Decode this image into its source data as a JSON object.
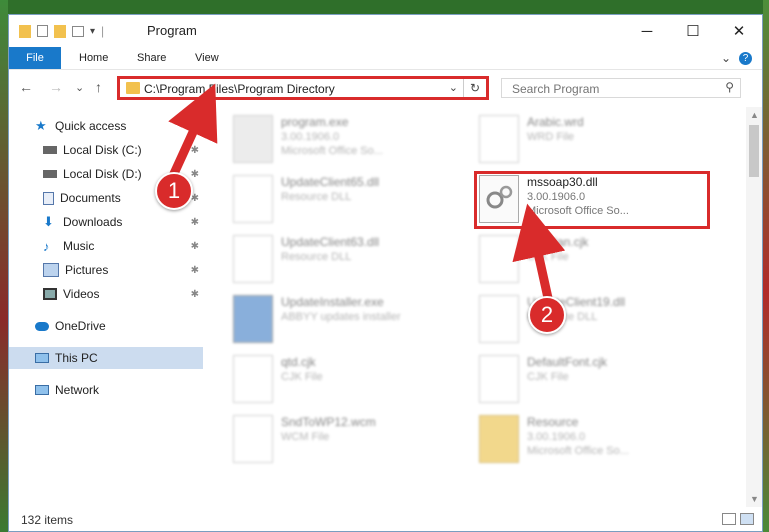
{
  "window": {
    "title": "Program",
    "controls": {
      "minimize": "─",
      "maximize": "☐",
      "close": "✕"
    }
  },
  "ribbon": {
    "file": "File",
    "tabs": [
      "Home",
      "Share",
      "View"
    ],
    "expand": "⌄",
    "help": "?"
  },
  "nav": {
    "back": "←",
    "forward": "→",
    "recent": "⌄",
    "up": "↑",
    "address": "C:\\Program Files\\Program Directory",
    "dropdown": "⌄",
    "refresh": "↻",
    "search_placeholder": "Search Program",
    "search_icon": "⚲"
  },
  "sidebar": {
    "items": [
      {
        "label": "Quick access",
        "icon": "star-icon"
      },
      {
        "label": "Local Disk (C:)",
        "icon": "drive-icon",
        "pin": "✱"
      },
      {
        "label": "Local Disk (D:)",
        "icon": "drive-icon",
        "pin": "✱"
      },
      {
        "label": "Documents",
        "icon": "documents-icon",
        "pin": "✱"
      },
      {
        "label": "Downloads",
        "icon": "download-icon",
        "pin": "✱"
      },
      {
        "label": "Music",
        "icon": "music-icon",
        "pin": "✱"
      },
      {
        "label": "Pictures",
        "icon": "pictures-icon",
        "pin": "✱"
      },
      {
        "label": "Videos",
        "icon": "videos-icon",
        "pin": "✱"
      },
      {
        "label": "OneDrive",
        "icon": "cloud-icon"
      },
      {
        "label": "This PC",
        "icon": "pc-icon"
      },
      {
        "label": "Network",
        "icon": "network-icon"
      }
    ]
  },
  "files": [
    {
      "name": "program.exe",
      "line2": "3.00.1906.0",
      "line3": "Microsoft Office So..."
    },
    {
      "name": "Arabic.wrd",
      "line2": "WRD File",
      "line3": ""
    },
    {
      "name": "UpdateClient65.dll",
      "line2": "Resource DLL",
      "line3": ""
    },
    {
      "name": "mssoap30.dll",
      "line2": "3.00.1906.0",
      "line3": "Microsoft Office So..."
    },
    {
      "name": "UpdateClient63.dll",
      "line2": "Resource DLL",
      "line3": ""
    },
    {
      "name": "Russian.cjk",
      "line2": "CJK File",
      "line3": ""
    },
    {
      "name": "UpdateInstaller.exe",
      "line2": "ABBYY updates installer",
      "line3": ""
    },
    {
      "name": "UpdateClient19.dll",
      "line2": "Resource DLL",
      "line3": ""
    },
    {
      "name": "qtd.cjk",
      "line2": "CJK File",
      "line3": ""
    },
    {
      "name": "DefaultFont.cjk",
      "line2": "CJK File",
      "line3": ""
    },
    {
      "name": "SndToWP12.wcm",
      "line2": "WCM File",
      "line3": ""
    },
    {
      "name": "Resource",
      "line2": "3.00.1906.0",
      "line3": "Microsoft Office So..."
    }
  ],
  "status": {
    "count": "132 items"
  },
  "annotations": {
    "step1": "1",
    "step2": "2"
  },
  "colors": {
    "accent": "#1979ca",
    "highlight": "#d92b2b",
    "selected": "#ccdcef"
  }
}
